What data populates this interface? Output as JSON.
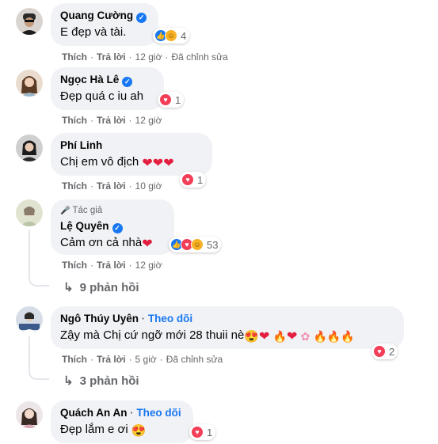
{
  "actions": {
    "like": "Thích",
    "reply": "Trả lời",
    "edited": "Đã chỉnh sửa"
  },
  "comments": [
    {
      "name": "Quang Cường",
      "text": "E đẹp và tài.",
      "time": "12 giờ",
      "reactions": "4"
    },
    {
      "name": "Ngọc Hà Lê",
      "text": "Đẹp quá c iu ah",
      "time": "12 giờ",
      "reactions": "1"
    },
    {
      "name": "Phí Linh",
      "text": "Chị em vô địch",
      "time": "10 giờ",
      "reactions": "1"
    },
    {
      "name": "Lệ Quyên",
      "author_tag": "Tác giả",
      "text": "Cảm ơn cả nhà",
      "time": "12 giờ",
      "reactions": "53",
      "replies": "9 phản hồi"
    },
    {
      "name": "Ngô Thúy Uyên",
      "follow": "Theo dõi",
      "text": "Zậy mà Chị cứ ngỡ mới 28 thuii nè",
      "time": "5 giờ",
      "reactions": "2",
      "replies": "3 phản hồi"
    },
    {
      "name": "Quách An An",
      "follow": "Theo dõi",
      "text": "Đẹp lắm e ơi",
      "reactions": "1"
    }
  ],
  "icons": {
    "verified": "verified-badge-icon",
    "like": "like-reaction-icon",
    "love": "love-reaction-icon",
    "care": "care-reaction-icon",
    "mic": "microphone-icon",
    "reply_arrow": "reply-arrow-icon"
  },
  "colors": {
    "accent": "#1877f2",
    "bubble": "#f0f2f5",
    "muted": "#65676b",
    "love": "#f33e58"
  }
}
